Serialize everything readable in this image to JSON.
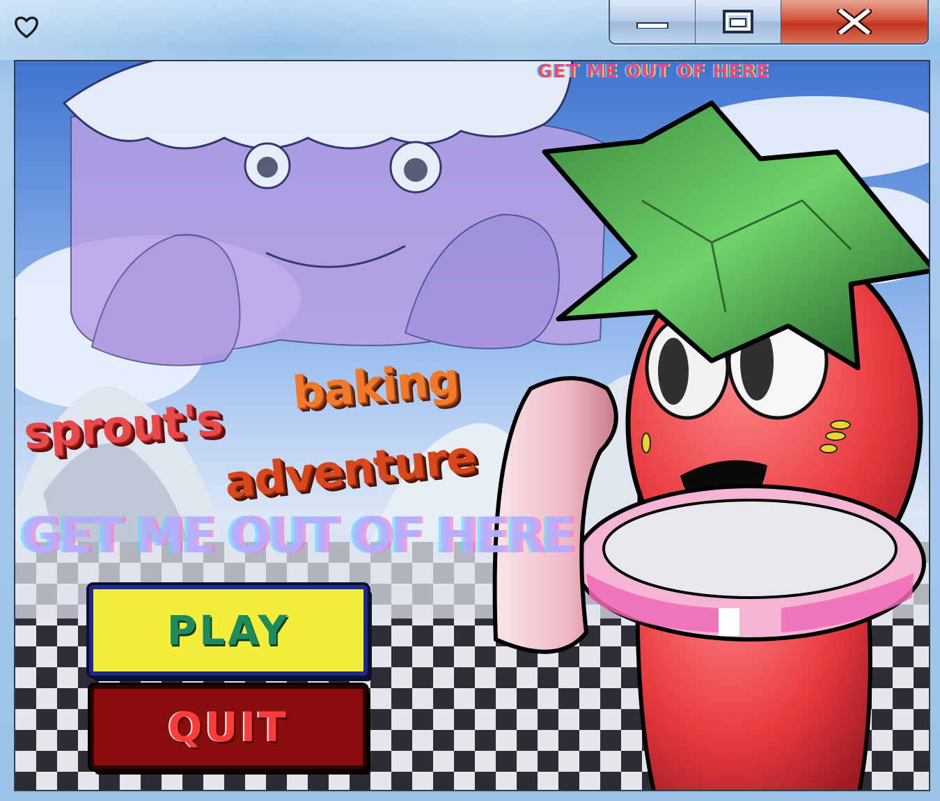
{
  "window": {
    "icon": "heart-icon",
    "buttons": [
      "minimize-icon",
      "maximize-icon",
      "close-icon"
    ]
  },
  "game": {
    "title_line1": "sprout's",
    "title_line2": "baking",
    "title_line3": "adventure",
    "overlay_text": "GET ME OUT OF HERE",
    "overlay_text_top": "GET ME OUT OF HERE",
    "play_label": "PLAY",
    "quit_label": "QUIT"
  },
  "colors": {
    "play_bg": "#f3ee3a",
    "play_text": "#1f8a5a",
    "quit_bg": "#8a0d0d",
    "quit_text": "#ff3b3b",
    "close_button": "#c2341c"
  }
}
